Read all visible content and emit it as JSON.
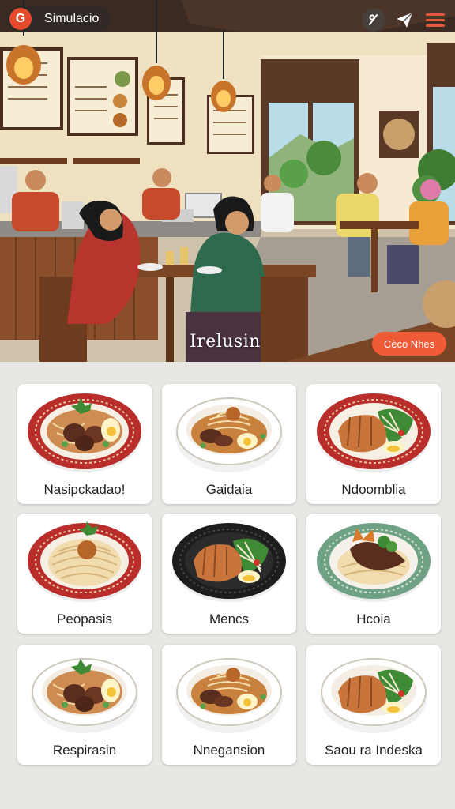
{
  "app": {
    "title": "Simulacio",
    "logo_letter": "G"
  },
  "toolbar": {
    "icons": [
      "tune-icon",
      "send-icon",
      "menu-icon"
    ]
  },
  "hero": {
    "title": "Irelusin",
    "cta_label": "Cèco Nhes"
  },
  "colors": {
    "accent": "#ef5b36",
    "logo": "#e54a2c",
    "grid_bg": "#e9e7e4"
  },
  "dishes": [
    {
      "name": "Nasipckadao!",
      "plate": "red-rim",
      "food": "meatballs"
    },
    {
      "name": "Gaidaia",
      "plate": "white-bowl",
      "food": "noodle-egg"
    },
    {
      "name": "Ndoomblia",
      "plate": "red-rim",
      "food": "fish-greens"
    },
    {
      "name": "Peopasis",
      "plate": "red-rim",
      "food": "noodles"
    },
    {
      "name": "Mencs",
      "plate": "black",
      "food": "fish-greens"
    },
    {
      "name": "Hcoia",
      "plate": "green-rim",
      "food": "meat-noodles"
    },
    {
      "name": "Respirasin",
      "plate": "white-bowl",
      "food": "meatballs"
    },
    {
      "name": "Nnegansion",
      "plate": "white-bowl",
      "food": "noodle-egg"
    },
    {
      "name": "Saou ra Indeska",
      "plate": "white-bowl",
      "food": "fish-greens"
    }
  ]
}
